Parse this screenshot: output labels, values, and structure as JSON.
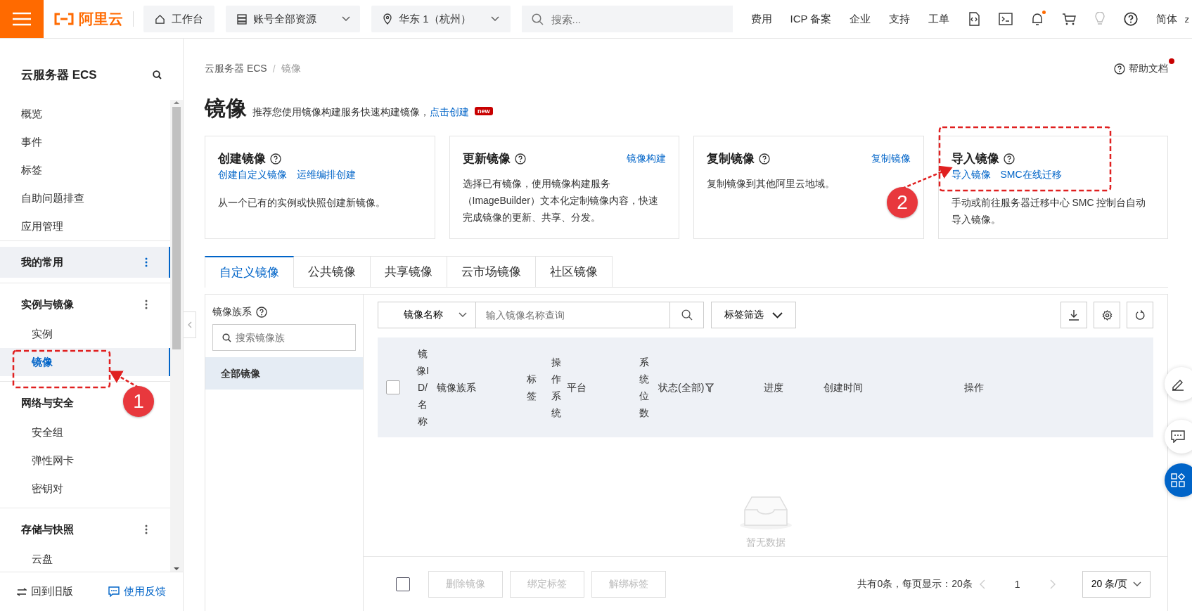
{
  "top_bar": {
    "logo": "阿里云",
    "workbench": "工作台",
    "resource_scope": "账号全部资源",
    "region": "华东 1（杭州）",
    "search": {
      "placeholder": "搜索..."
    },
    "links": [
      "费用",
      "ICP 备案",
      "企业",
      "支持",
      "工单"
    ],
    "language": "简体",
    "user_initial": "z"
  },
  "sidebar": {
    "title": "云服务器 ECS",
    "items": [
      "概览",
      "事件",
      "标签",
      "自助问题排查",
      "应用管理"
    ],
    "groups": [
      {
        "title": "我的常用",
        "selected": true
      },
      {
        "title": "实例与镜像",
        "selected": false,
        "items": [
          {
            "label": "实例",
            "selected": false
          },
          {
            "label": "镜像",
            "selected": true
          }
        ]
      },
      {
        "title": "网络与安全",
        "selected": false,
        "items": [
          {
            "label": "安全组",
            "selected": false
          },
          {
            "label": "弹性网卡",
            "selected": false
          },
          {
            "label": "密钥对",
            "selected": false
          }
        ]
      },
      {
        "title": "存储与快照",
        "selected": false,
        "items": [
          {
            "label": "云盘",
            "selected": false
          }
        ]
      }
    ],
    "footer": {
      "back_to_old": "回到旧版",
      "feedback": "使用反馈"
    }
  },
  "breadcrumb": [
    "云服务器 ECS",
    "镜像"
  ],
  "breadcrumb_separator": "/",
  "help_link": "帮助文档",
  "page": {
    "title": "镜像",
    "subtitle": "推荐您使用镜像构建服务快速构建镜像，",
    "link": "点击创建",
    "badge": "new"
  },
  "cards": [
    {
      "title": "创建镜像",
      "links": [
        "创建自定义镜像",
        "运维编排创建"
      ],
      "description": "从一个已有的实例或快照创建新镜像。"
    },
    {
      "title": "更新镜像",
      "header_link": "镜像构建",
      "description": "选择已有镜像，使用镜像构建服务（ImageBuilder）文本化定制镜像内容，快速完成镜像的更新、共享、分发。"
    },
    {
      "title": "复制镜像",
      "header_link": "复制镜像",
      "description": "复制镜像到其他阿里云地域。"
    },
    {
      "title": "导入镜像",
      "links": [
        "导入镜像",
        "SMC在线迁移"
      ],
      "description": "手动或前往服务器迁移中心 SMC 控制台自动导入镜像。"
    }
  ],
  "tabs": [
    {
      "label": "自定义镜像",
      "selected": true
    },
    {
      "label": "公共镜像",
      "selected": false
    },
    {
      "label": "共享镜像",
      "selected": false
    },
    {
      "label": "云市场镜像",
      "selected": false
    },
    {
      "label": "社区镜像",
      "selected": false
    }
  ],
  "family_panel": {
    "title": "镜像族系",
    "search": {
      "placeholder": "搜索镜像族"
    },
    "items": [
      {
        "label": "全部镜像",
        "selected": true
      }
    ]
  },
  "toolbar": {
    "filter_select": "镜像名称",
    "search": {
      "placeholder": "输入镜像名称查询"
    },
    "tag_filter": "标签筛选"
  },
  "table": {
    "select_all": {
      "checked": false
    },
    "columns": [
      "镜像ID/名称",
      "镜像族系",
      "标签",
      "操作系统",
      "平台",
      "系统位数",
      "状态(全部)",
      "进度",
      "创建时间",
      "操作"
    ],
    "empty_text": "暂无数据"
  },
  "footer": {
    "select_all": {
      "checked": false
    },
    "buttons": [
      {
        "label": "删除镜像",
        "disabled": true
      },
      {
        "label": "绑定标签",
        "disabled": true
      },
      {
        "label": "解绑标签",
        "disabled": true
      }
    ],
    "summary": "共有0条，每页显示：20条",
    "page": "1",
    "page_size": "20 条/页"
  },
  "annotations": [
    {
      "number": "1"
    },
    {
      "number": "2"
    }
  ]
}
